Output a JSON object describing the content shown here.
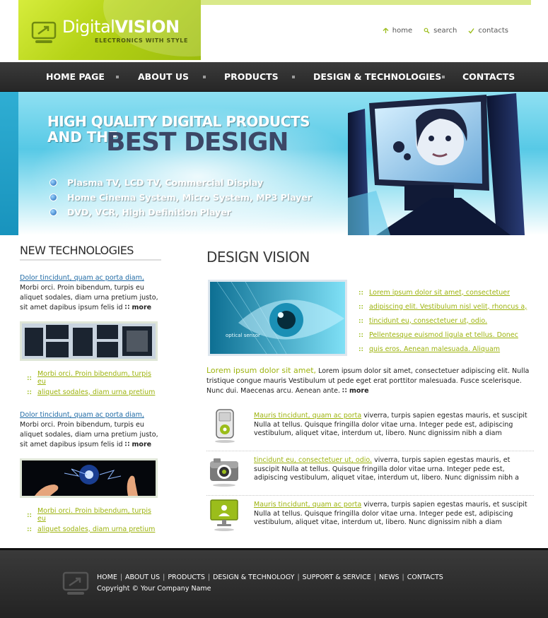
{
  "logo": {
    "digital": "Digital",
    "vision": "VISION",
    "tagline": "ELECTRONICS WITH STYLE"
  },
  "toplinks": [
    {
      "label": "home",
      "icon": "home-icon"
    },
    {
      "label": "search",
      "icon": "search-icon"
    },
    {
      "label": "contacts",
      "icon": "contacts-icon"
    }
  ],
  "nav": [
    "HOME PAGE",
    "ABOUT US",
    "PRODUCTS",
    "DESIGN & TECHNOLOGIES",
    "CONTACTS"
  ],
  "banner": {
    "line1": "HIGH QUALITY DIGITAL PRODUCTS",
    "line2_prefix": "AND THE",
    "line2_big": "BEST DESIGN",
    "bullets": [
      "Plasma TV, LCD TV, Commercial Display",
      "Home Cinema System, Micro System, MP3 Player",
      "DVD, VCR, High Definition Player"
    ]
  },
  "left": {
    "title": "NEW TECHNOLOGIES",
    "news1": {
      "link": "Dolor tincidunt, quam ac porta diam,",
      "text": "Morbi orci. Proin bibendum, turpis eu aliquet sodales, diam urna pretium justo, sit amet dapibus ipsum felis id",
      "more": "more"
    },
    "links1": [
      "Morbi orci. Proin bibendum, turpis eu",
      "aliquet sodales, diam urna pretium"
    ],
    "news2": {
      "link": "Dolor tincidunt, quam ac porta diam,",
      "text": "Morbi orci. Proin bibendum, turpis eu aliquet sodales, diam urna pretium justo, sit amet dapibus ipsum felis id",
      "more": "more"
    },
    "links2": [
      "Morbi orci. Proin bibendum, turpis eu",
      "aliquet sodales, diam urna pretium"
    ]
  },
  "right": {
    "title": "DESIGN VISION",
    "feature_caption": "optical sensor",
    "feature_links": [
      "Lorem ipsum dolor sit amet, consectetuer",
      "adipiscing elit. Vestibulum nisl velit, rhoncus a,",
      "tincidunt eu, consectetuer ut, odio.",
      "Pellentesque euismod ligula et tellus. Donec",
      "quis eros. Aenean malesuada. Aliquam"
    ],
    "intro_lead": "Lorem ipsum dolor sit amet,",
    "intro_text": "Lorem ipsum dolor sit amet, consectetuer adipiscing elit. Nulla tristique congue mauris Vestibulum ut pede eget erat porttitor malesuada. Fusce scelerisque. Nunc dui. Maecenas arcu. Aenean ante.",
    "intro_more": "more",
    "items": [
      {
        "icon": "mp3-player-icon",
        "link": "Mauris tincidunt, quam ac porta",
        "text": "viverra, turpis sapien egestas mauris, et suscipit Nulla at tellus. Quisque fringilla dolor vitae urna. Integer pede est, adipiscing vestibulum, aliquet vitae, interdum ut, libero. Nunc dignissim nibh a diam"
      },
      {
        "icon": "camera-icon",
        "link": "tincidunt eu, consectetuer ut, odio.",
        "text": "viverra, turpis sapien egestas mauris, et suscipit Nulla at tellus. Quisque fringilla dolor vitae urna. Integer pede est, adipiscing vestibulum, aliquet vitae, interdum ut, libero. Nunc dignissim nibh a"
      },
      {
        "icon": "monitor-icon",
        "link": "Mauris tincidunt, quam ac porta",
        "text": "viverra, turpis sapien egestas mauris, et suscipit Nulla at tellus. Quisque fringilla dolor vitae urna. Integer pede est, adipiscing vestibulum, aliquet vitae, interdum ut, libero. Nunc dignissim nibh a diam"
      }
    ]
  },
  "footer": {
    "links": [
      "HOME",
      "ABOUT US",
      "PRODUCTS",
      "DESIGN & TECHNOLOGY",
      "SUPPORT & SERVICE",
      "NEWS",
      "CONTACTS"
    ],
    "copyright": "Copyright © Your Company Name"
  },
  "colors": {
    "accent_green": "#9db30e",
    "link_blue": "#1f6aa5",
    "nav_bg": "#2e2e2e",
    "footer_bg": "#2b2b2b"
  }
}
